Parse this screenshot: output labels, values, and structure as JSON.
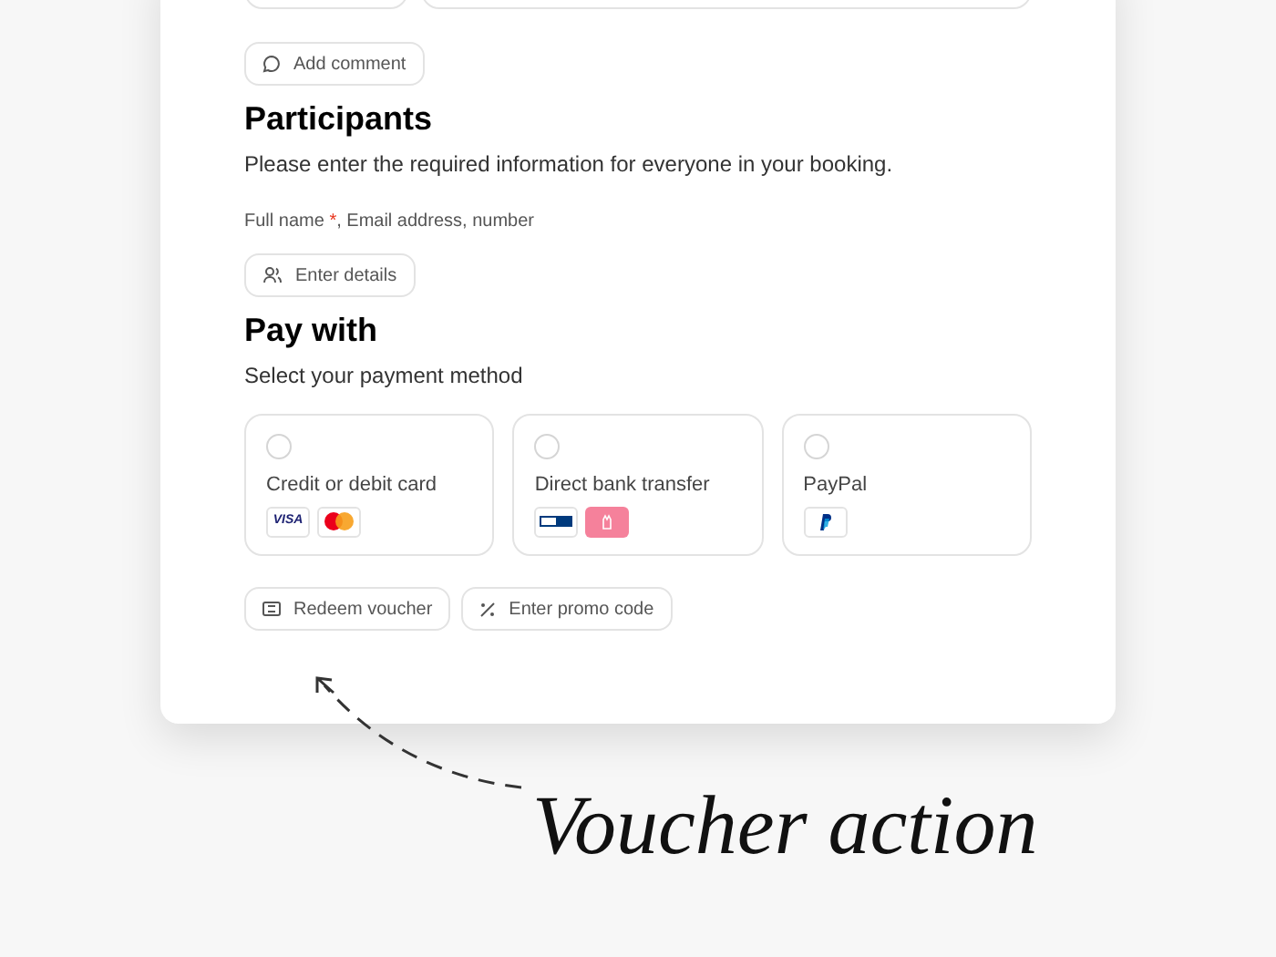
{
  "comment_button": {
    "label": "Add comment"
  },
  "participants": {
    "title": "Participants",
    "description": "Please enter the required information for everyone in your booking.",
    "fields_label": {
      "before": "Full name ",
      "required_mark": "*",
      "after": ", Email address, number"
    },
    "button": {
      "label": "Enter details"
    }
  },
  "payment": {
    "title": "Pay with",
    "description": "Select your payment method",
    "methods": [
      {
        "label": "Credit or debit card",
        "selected": false,
        "logos": [
          {
            "kind": "visa",
            "text": "VISA"
          },
          {
            "kind": "mastercard"
          }
        ]
      },
      {
        "label": "Direct bank transfer",
        "selected": false,
        "logos": [
          {
            "kind": "giropay"
          },
          {
            "kind": "pink"
          }
        ]
      },
      {
        "label": "PayPal",
        "selected": false,
        "logos": [
          {
            "kind": "paypal"
          }
        ]
      }
    ]
  },
  "actions": [
    {
      "kind": "voucher",
      "label": "Redeem voucher"
    },
    {
      "kind": "promo",
      "label": "Enter promo code"
    }
  ],
  "annotation": {
    "text": "Voucher action"
  }
}
